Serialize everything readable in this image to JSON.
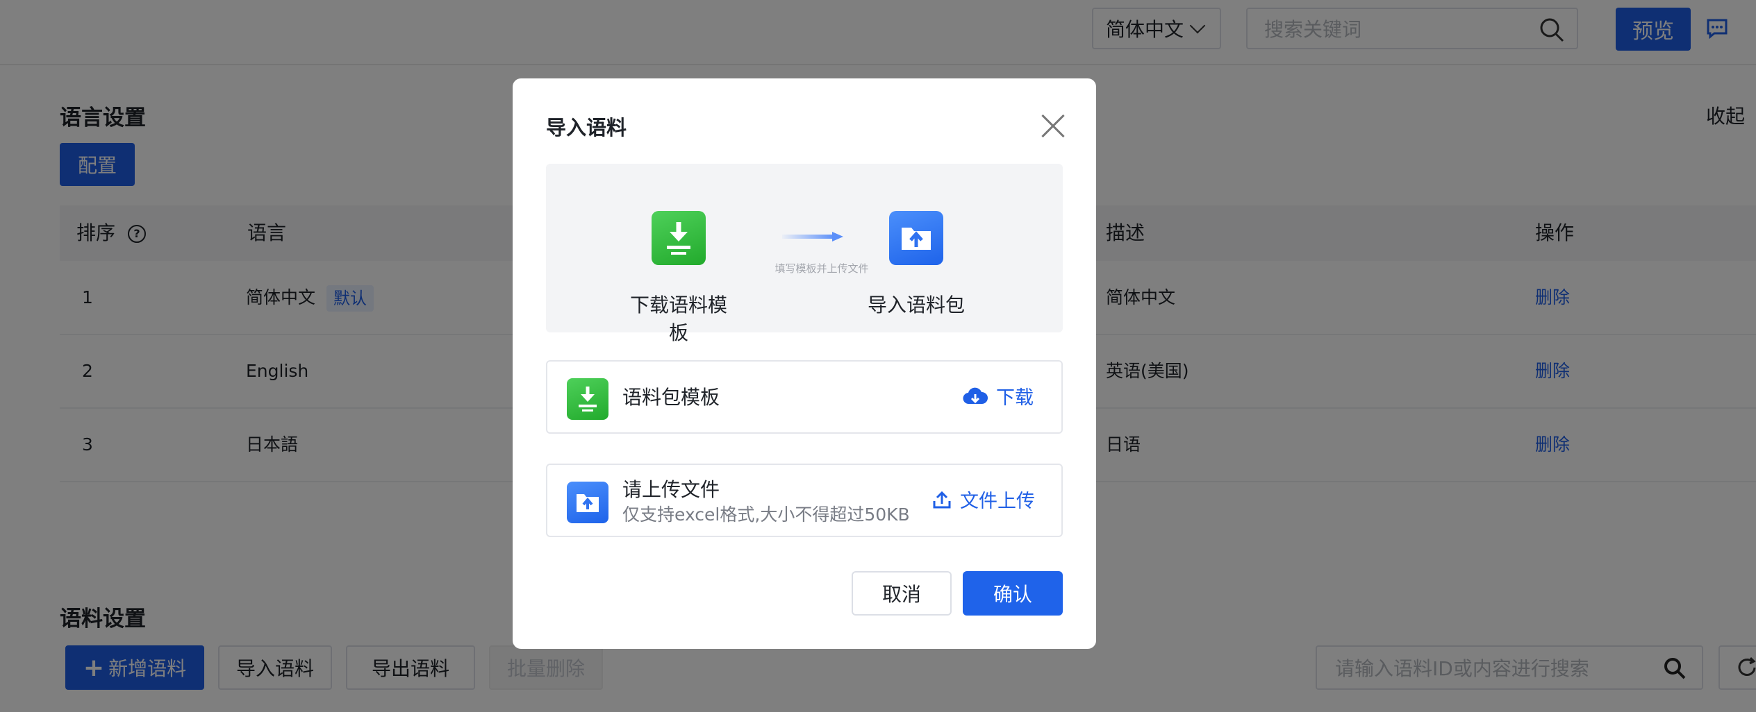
{
  "header": {
    "language_select": "简体中文",
    "search_placeholder": "搜索关键词",
    "preview_label": "预览"
  },
  "language_section": {
    "title": "语言设置",
    "collapse_label": "收起",
    "config_label": "配置",
    "columns": [
      "排序",
      "语言",
      "描述",
      "操作"
    ],
    "help_glyph": "?",
    "default_badge": "默认",
    "rows": [
      {
        "order": "1",
        "language": "简体中文",
        "description": "简体中文",
        "action": "删除"
      },
      {
        "order": "2",
        "language": "English",
        "description": "英语(美国)",
        "action": "删除"
      },
      {
        "order": "3",
        "language": "日本語",
        "description": "日语",
        "action": "删除"
      }
    ]
  },
  "corpus_section": {
    "title": "语料设置",
    "add_label": "新增语料",
    "import_label": "导入语料",
    "export_label": "导出语料",
    "batch_delete_label": "批量删除",
    "search_placeholder": "请输入语料ID或内容进行搜索"
  },
  "modal": {
    "title": "导入语料",
    "step1_label": "下载语料模板",
    "step2_label": "导入语料包",
    "step_hint": "填写模板并上传文件",
    "template_card": {
      "name": "语料包模板",
      "action": "下载"
    },
    "upload_card": {
      "title": "请上传文件",
      "hint": "仅支持excel格式,大小不得超过50KB",
      "action": "文件上传"
    },
    "cancel_label": "取消",
    "confirm_label": "确认"
  },
  "colors": {
    "primary": "#1f5fe6",
    "green_icon": "#2fb83a",
    "blue_icon": "#2f72f0",
    "overlay": "rgba(0,0,0,0.5)"
  }
}
